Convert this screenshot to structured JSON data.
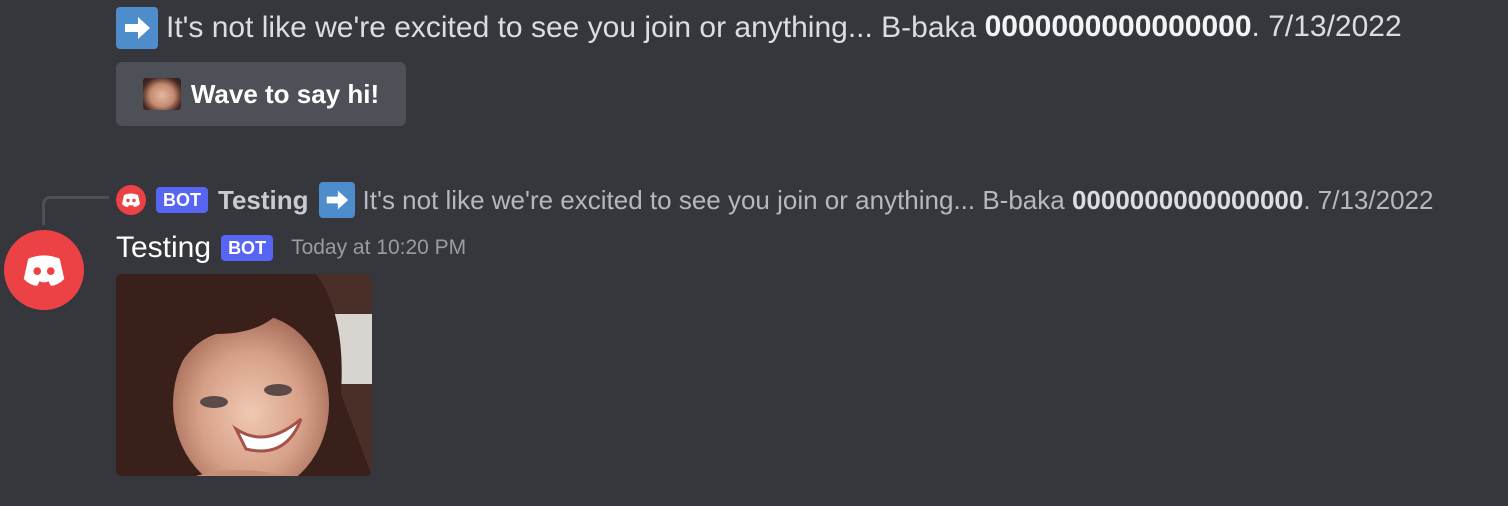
{
  "system_message": {
    "emoji": "arrow-right-emoji",
    "text": "It's not like we're excited to see you join or anything... B-baka",
    "username": "0000000000000000",
    "date_suffix": ". 7/13/2022"
  },
  "wave_button": {
    "label": "Wave to say hi!"
  },
  "reply": {
    "bot_tag": "BOT",
    "name": "Testing",
    "text": "It's not like we're excited to see you join or anything... B-baka",
    "username": "0000000000000000",
    "date_suffix": ". 7/13/2022"
  },
  "message": {
    "username": "Testing",
    "bot_tag": "BOT",
    "timestamp": "Today at 10:20 PM"
  },
  "colors": {
    "background": "#36373d",
    "blurple": "#5865f2",
    "avatar_red": "#ed4245",
    "button_bg": "#4e5058"
  }
}
